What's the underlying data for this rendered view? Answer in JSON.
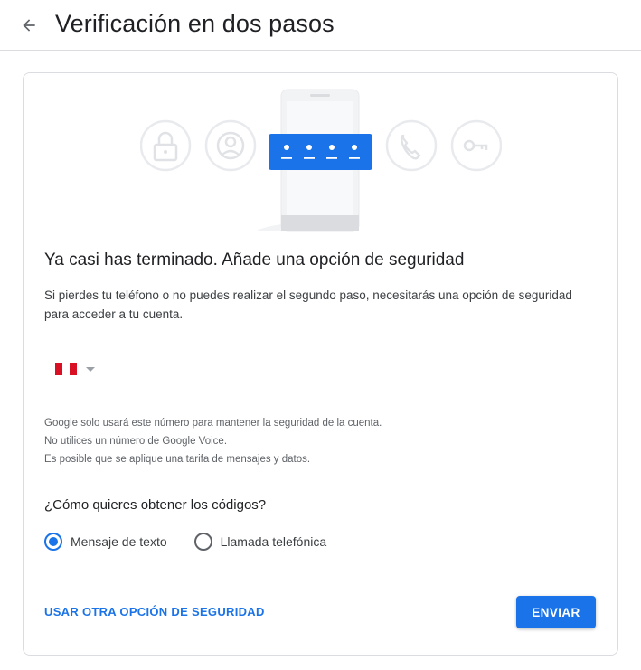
{
  "header": {
    "back_icon": "arrow-back-icon",
    "title": "Verificación en dos pasos"
  },
  "illustration": {
    "icons": [
      "lock-icon",
      "account-circle-icon",
      "phone-icon",
      "key-icon"
    ],
    "code_mask": "••••"
  },
  "content": {
    "heading": "Ya casi has terminado. Añade una opción de seguridad",
    "description": "Si pierdes tu teléfono o no puedes realizar el segundo paso, necesitarás una opción de seguridad para acceder a tu cuenta."
  },
  "phone": {
    "country_flag": "peru-flag-icon",
    "value": "",
    "placeholder": ""
  },
  "notes": [
    "Google solo usará este número para mantener la seguridad de la cuenta.",
    "No utilices un número de Google Voice.",
    "Es posible que se aplique una tarifa de mensajes y datos."
  ],
  "method": {
    "question": "¿Cómo quieres obtener los códigos?",
    "options": [
      {
        "label": "Mensaje de texto",
        "checked": true
      },
      {
        "label": "Llamada telefónica",
        "checked": false
      }
    ]
  },
  "actions": {
    "other_option": "USAR OTRA OPCIÓN DE SEGURIDAD",
    "send": "ENVIAR"
  },
  "colors": {
    "accent": "#1a73e8",
    "flag_red": "#d91023"
  }
}
